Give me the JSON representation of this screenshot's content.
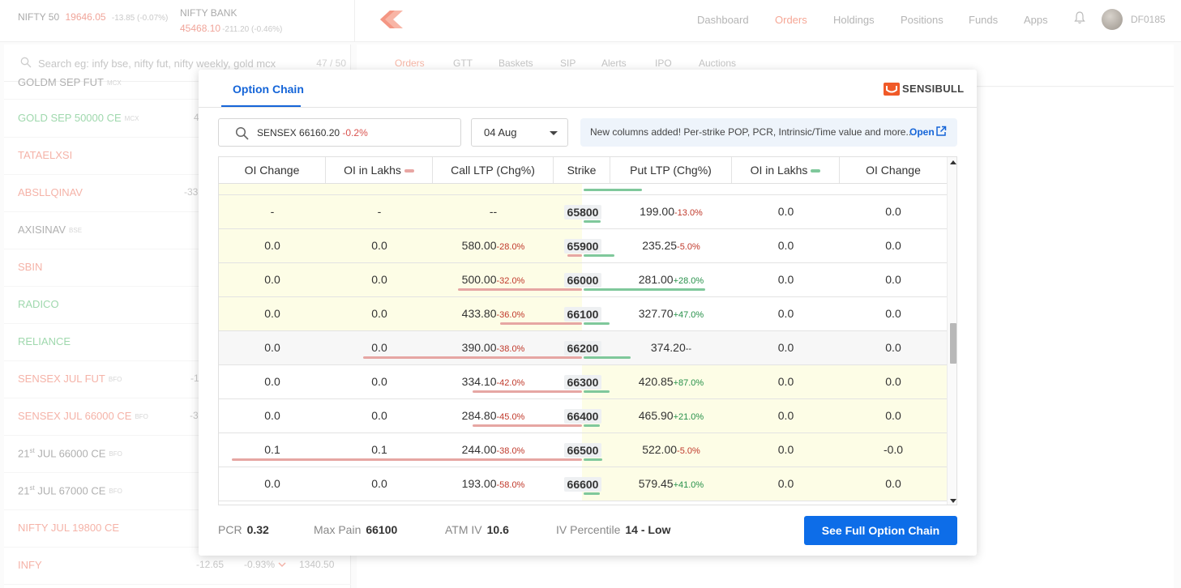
{
  "header": {
    "nifty50": {
      "name": "NIFTY 50",
      "value": "19646.05",
      "change": "-13.85 (-0.07%)"
    },
    "niftybank": {
      "name": "NIFTY BANK",
      "value": "45468.10",
      "change": "-211.20 (-0.46%)"
    },
    "nav": [
      "Dashboard",
      "Orders",
      "Holdings",
      "Positions",
      "Funds",
      "Apps"
    ],
    "active_nav": "Orders",
    "user_id": "DF0185"
  },
  "watchlist": {
    "search_placeholder": "Search eg: infy bse, nifty fut, nifty weekly, gold mcx",
    "count": "47 / 50",
    "items": [
      {
        "name": "GOLDM SEP FUT",
        "exchange": "MCX",
        "value": ""
      },
      {
        "name": "GOLD SEP 50000 CE",
        "exchange": "MCX",
        "value": "4"
      },
      {
        "name": "TATAELXSI",
        "exchange": "",
        "value": ""
      },
      {
        "name": "ABSLLQINAV",
        "exchange": "",
        "value": "-33"
      },
      {
        "name": "AXISINAV",
        "exchange": "BSE",
        "value": ""
      },
      {
        "name": "SBIN",
        "exchange": "",
        "value": ""
      },
      {
        "name": "RADICO",
        "exchange": "",
        "value": ""
      },
      {
        "name": "RELIANCE",
        "exchange": "",
        "value": ""
      },
      {
        "name": "SENSEX JUL FUT",
        "exchange": "BFO",
        "value": "-1"
      },
      {
        "name": "SENSEX JUL 66000 CE",
        "exchange": "BFO",
        "value": "-3"
      },
      {
        "name": "21",
        "sup": "st",
        "rest": "JUL 66000 CE",
        "exchange": "BFO",
        "value": ""
      },
      {
        "name": "21",
        "sup": "st",
        "rest": "JUL 67000 CE",
        "exchange": "BFO",
        "value": ""
      },
      {
        "name": "NIFTY JUL 19800 CE",
        "exchange": "",
        "value": ""
      },
      {
        "name": "INFY",
        "exchange": "",
        "value": "-12.65",
        "pct": "-0.93%",
        "ltp": "1340.50"
      }
    ]
  },
  "subtabs": [
    "Orders",
    "GTT",
    "Baskets",
    "SIP",
    "Alerts",
    "IPO",
    "Auctions"
  ],
  "modal": {
    "tab": "Option Chain",
    "brand": "SENSIBULL",
    "symbol": "SENSEX 66160.20",
    "symbol_change": "-0.2%",
    "expiry": "04 Aug",
    "notice": "New columns added! Per-strike POP, PCR, Intrinsic/Time value and more...",
    "notice_link": "Open",
    "columns": [
      "OI Change",
      "OI in Lakhs",
      "Call LTP (Chg%)",
      "Strike",
      "Put LTP (Chg%)",
      "OI in Lakhs",
      "OI Change"
    ],
    "rows": [
      {
        "strike": "65800",
        "c_oichg": "-",
        "c_oi": "-",
        "c_ltp": "--",
        "c_chg": "",
        "p_ltp": "199.00",
        "p_chg": "-13.0%",
        "p_oi": "0.0",
        "p_oichg": "0.0"
      },
      {
        "strike": "65900",
        "c_oichg": "0.0",
        "c_oi": "0.0",
        "c_ltp": "580.00",
        "c_chg": "-28.0%",
        "p_ltp": "235.25",
        "p_chg": "-5.0%",
        "p_oi": "0.0",
        "p_oichg": "0.0"
      },
      {
        "strike": "66000",
        "c_oichg": "0.0",
        "c_oi": "0.0",
        "c_ltp": "500.00",
        "c_chg": "-32.0%",
        "p_ltp": "281.00",
        "p_chg": "+28.0%",
        "p_oi": "0.0",
        "p_oichg": "0.0"
      },
      {
        "strike": "66100",
        "c_oichg": "0.0",
        "c_oi": "0.0",
        "c_ltp": "433.80",
        "c_chg": "-36.0%",
        "p_ltp": "327.70",
        "p_chg": "+47.0%",
        "p_oi": "0.0",
        "p_oichg": "0.0"
      },
      {
        "strike": "66200",
        "c_oichg": "0.0",
        "c_oi": "0.0",
        "c_ltp": "390.00",
        "c_chg": "-38.0%",
        "p_ltp": "374.20",
        "p_chg": "--",
        "p_oi": "0.0",
        "p_oichg": "0.0"
      },
      {
        "strike": "66300",
        "c_oichg": "0.0",
        "c_oi": "0.0",
        "c_ltp": "334.10",
        "c_chg": "-42.0%",
        "p_ltp": "420.85",
        "p_chg": "+87.0%",
        "p_oi": "0.0",
        "p_oichg": "0.0"
      },
      {
        "strike": "66400",
        "c_oichg": "0.0",
        "c_oi": "0.0",
        "c_ltp": "284.80",
        "c_chg": "-45.0%",
        "p_ltp": "465.90",
        "p_chg": "+21.0%",
        "p_oi": "0.0",
        "p_oichg": "0.0"
      },
      {
        "strike": "66500",
        "c_oichg": "0.1",
        "c_oi": "0.1",
        "c_ltp": "244.00",
        "c_chg": "-38.0%",
        "p_ltp": "522.00",
        "p_chg": "-5.0%",
        "p_oi": "0.0",
        "p_oichg": "-0.0"
      },
      {
        "strike": "66600",
        "c_oichg": "0.0",
        "c_oi": "0.0",
        "c_ltp": "193.00",
        "c_chg": "-58.0%",
        "p_ltp": "579.45",
        "p_chg": "+41.0%",
        "p_oi": "0.0",
        "p_oichg": "0.0"
      }
    ],
    "footer": {
      "pcr_label": "PCR",
      "pcr": "0.32",
      "maxpain_label": "Max Pain",
      "maxpain": "66100",
      "atmiv_label": "ATM IV",
      "atmiv": "10.6",
      "ivp_label": "IV Percentile",
      "ivp": "14 - Low",
      "button": "See Full Option Chain"
    }
  },
  "colors": {
    "accent": "#0d6de8",
    "brand": "#f6a796",
    "itm_bg": "#fdfde6"
  }
}
